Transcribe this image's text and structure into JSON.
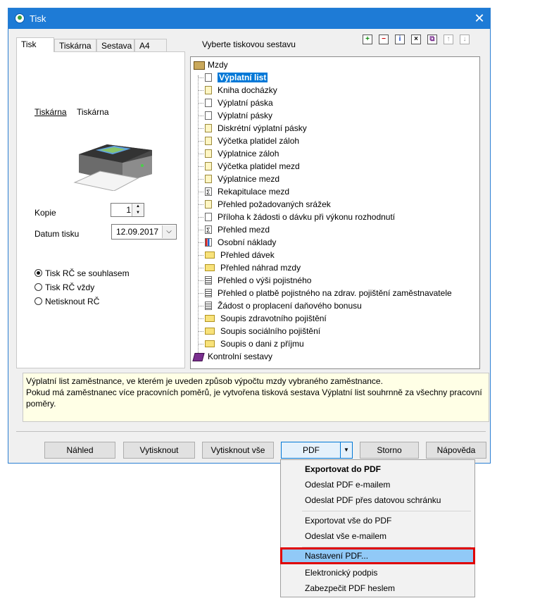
{
  "window": {
    "title": "Tisk",
    "close_glyph": "✕"
  },
  "tabs": [
    "Tisk",
    "Tiskárna",
    "Sestava",
    "A4"
  ],
  "left_panel": {
    "printer_label": "Tiskárna",
    "printer_value": "Tiskárna",
    "copies_label": "Kopie",
    "copies_value": "1",
    "date_label": "Datum tisku",
    "date_value": "12.09.2017",
    "radios": [
      {
        "label": "Tisk RČ se souhlasem",
        "checked": true
      },
      {
        "label": "Tisk RČ vždy",
        "checked": false
      },
      {
        "label": "Netisknout RČ",
        "checked": false
      }
    ]
  },
  "tree": {
    "header": "Vyberte tiskovou sestavu",
    "root": "Mzdy",
    "items": [
      {
        "label": "Výplatní list",
        "icon": "page",
        "selected": true
      },
      {
        "label": "Kniha docházky",
        "icon": "yellow-page"
      },
      {
        "label": "Výplatní páska",
        "icon": "page"
      },
      {
        "label": "Výplatní pásky",
        "icon": "page"
      },
      {
        "label": "Diskrétní výplatní pásky",
        "icon": "yellow-page"
      },
      {
        "label": "Výčetka platidel záloh",
        "icon": "yellow-page"
      },
      {
        "label": "Výplatnice záloh",
        "icon": "yellow-page"
      },
      {
        "label": "Výčetka platidel mezd",
        "icon": "yellow-page"
      },
      {
        "label": "Výplatnice mezd",
        "icon": "yellow-page"
      },
      {
        "label": "Rekapitulace mezd",
        "icon": "sigma"
      },
      {
        "label": "Přehled požadovaných srážek",
        "icon": "yellow-page"
      },
      {
        "label": "Příloha k žádosti o dávku při výkonu rozhodnutí",
        "icon": "page"
      },
      {
        "label": "Přehled mezd",
        "icon": "sigma"
      },
      {
        "label": "Osobní náklady",
        "icon": "chart"
      },
      {
        "label": "Přehled dávek",
        "icon": "folder"
      },
      {
        "label": "Přehled náhrad mzdy",
        "icon": "folder"
      },
      {
        "label": "Přehled o výši pojistného",
        "icon": "lines"
      },
      {
        "label": "Přehled o platbě pojistného na zdrav. pojištění zaměstnavatele",
        "icon": "lines"
      },
      {
        "label": "Žádost o proplacení daňového bonusu",
        "icon": "lines"
      },
      {
        "label": "Soupis zdravotního pojištění",
        "icon": "folder"
      },
      {
        "label": "Soupis sociálního pojištění",
        "icon": "folder"
      },
      {
        "label": "Soupis o dani z příjmu",
        "icon": "folder"
      }
    ],
    "second_root": "Kontrolní sestavy",
    "toolbar_icons": [
      "add-icon",
      "remove-icon",
      "info-icon",
      "close-icon",
      "copy-icon",
      "move-up-icon",
      "move-down-icon"
    ],
    "toolbar_glyphs": [
      "+",
      "−",
      "i",
      "×",
      "⧉",
      "↑",
      "↓"
    ]
  },
  "description": {
    "line1": "Výplatní list zaměstnance, ve kterém je uveden způsob výpočtu mzdy vybraného zaměstnance.",
    "line2": "Pokud má zaměstnanec více pracovních poměrů, je vytvořena tisková sestava Výplatní list souhrnně za všechny pracovní",
    "line3": "poměry."
  },
  "buttons": {
    "preview": "Náhled",
    "print": "Vytisknout",
    "print_all": "Vytisknout vše",
    "pdf": "PDF",
    "cancel": "Storno",
    "help": "Nápověda"
  },
  "pdf_menu": [
    {
      "label": "Exportovat do PDF",
      "bold": true
    },
    {
      "label": "Odeslat PDF e-mailem"
    },
    {
      "label": "Odeslat PDF přes datovou schránku"
    },
    {
      "label": "Exportovat vše do PDF"
    },
    {
      "label": "Odeslat vše e-mailem"
    },
    {
      "label": "Nastavení PDF...",
      "highlighted": true
    },
    {
      "label": "Elektronický podpis"
    },
    {
      "label": "Zabezpečit PDF heslem"
    }
  ],
  "colors": {
    "titlebar": "#1e7bd6",
    "selection": "#0078d7",
    "highlight_border": "#e00000",
    "menu_highlight": "#91c9f7"
  }
}
